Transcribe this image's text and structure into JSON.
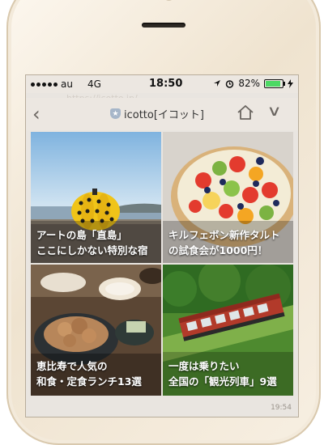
{
  "status": {
    "carrier": "au",
    "network": "4G",
    "time": "18:50",
    "battery": "82%",
    "battery_level": 0.82
  },
  "url_ghost": "https://icotto.jp/",
  "nav": {
    "back_glyph": "‹",
    "site_name": "icotto[イコット]",
    "more_glyph": "∨"
  },
  "tiles": [
    {
      "line1": "アートの島「直島」",
      "line2": "ここにしかない特別な宿"
    },
    {
      "line1": "キルフェボン新作タルト",
      "line2": "の試食会が1000円！"
    },
    {
      "line1": "恵比寿で人気の",
      "line2": "和食・定食ランチ13選"
    },
    {
      "line1": "一度は乗りたい",
      "line2": "全国の「観光列車」9選"
    }
  ],
  "stamp": "19:54",
  "colors": {
    "battery_fill": "#4cd964",
    "chrome": "#ece7e1"
  }
}
